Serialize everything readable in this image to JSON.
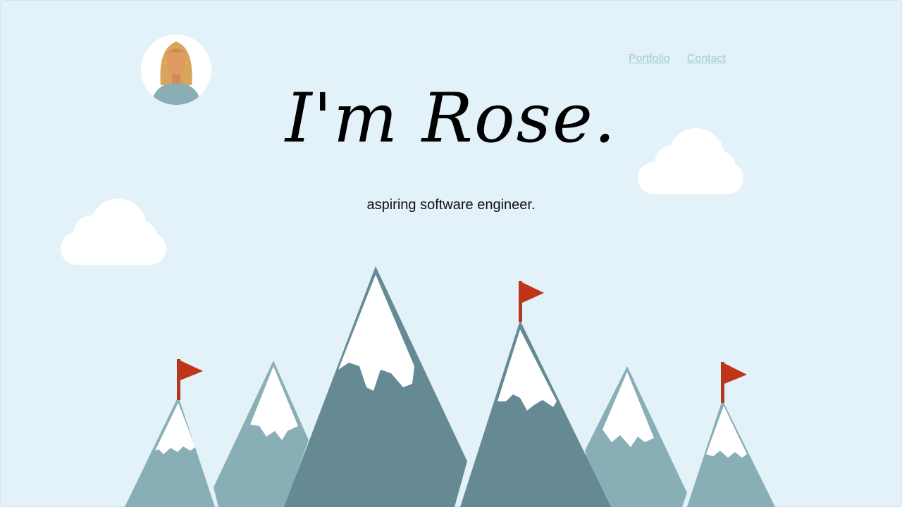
{
  "nav": {
    "portfolio": "Portfolio",
    "contact": "Contact"
  },
  "hero": {
    "title": "I'm Rose.",
    "subtitle": "aspiring software engineer."
  },
  "colors": {
    "background": "#e3f2f8",
    "link": "#9ec9d1",
    "mountain_dark": "#658a94",
    "mountain_light": "#88aeb6",
    "snow": "#ffffff",
    "flag": "#c0341a"
  },
  "icons": {
    "avatar": "woman-avatar-icon",
    "flag": "red-flag-icon",
    "cloud": "cloud-icon"
  }
}
